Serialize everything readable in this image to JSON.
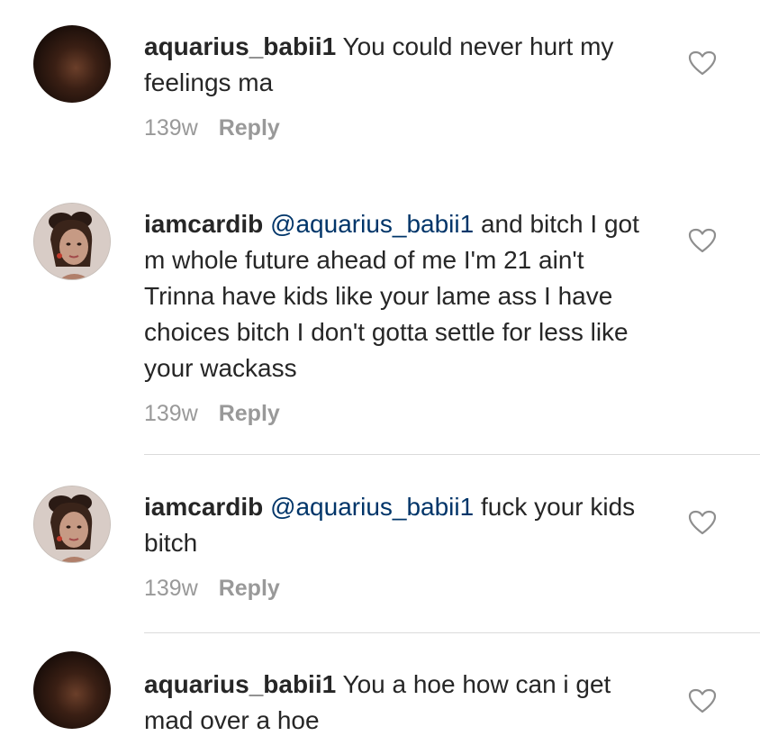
{
  "comments": [
    {
      "username": "aquarius_babii1",
      "mention": "",
      "text": "You could never hurt my feelings ma",
      "time": "139w",
      "reply_label": "Reply",
      "avatar": "dark-selfie-avatar"
    },
    {
      "username": "iamcardib",
      "mention": "@aquarius_babii1",
      "text": "and bitch I got m whole future ahead of me I'm 21 ain't Trinna have kids like your lame ass I have choices bitch I don't gotta settle for less like your wackass",
      "time": "139w",
      "reply_label": "Reply",
      "avatar": "portrait-avatar"
    },
    {
      "username": "iamcardib",
      "mention": "@aquarius_babii1",
      "text": "fuck your kids bitch",
      "time": "139w",
      "reply_label": "Reply",
      "avatar": "portrait-avatar"
    },
    {
      "username": "aquarius_babii1",
      "mention": "",
      "text": "You a hoe how can i get mad over a hoe",
      "time": "",
      "reply_label": "",
      "avatar": "dark-selfie-avatar"
    }
  ],
  "icons": {
    "like": "heart-outline-icon"
  },
  "colors": {
    "text": "#262626",
    "mention": "#003569",
    "meta": "#999999",
    "divider": "#dbdbdb"
  }
}
